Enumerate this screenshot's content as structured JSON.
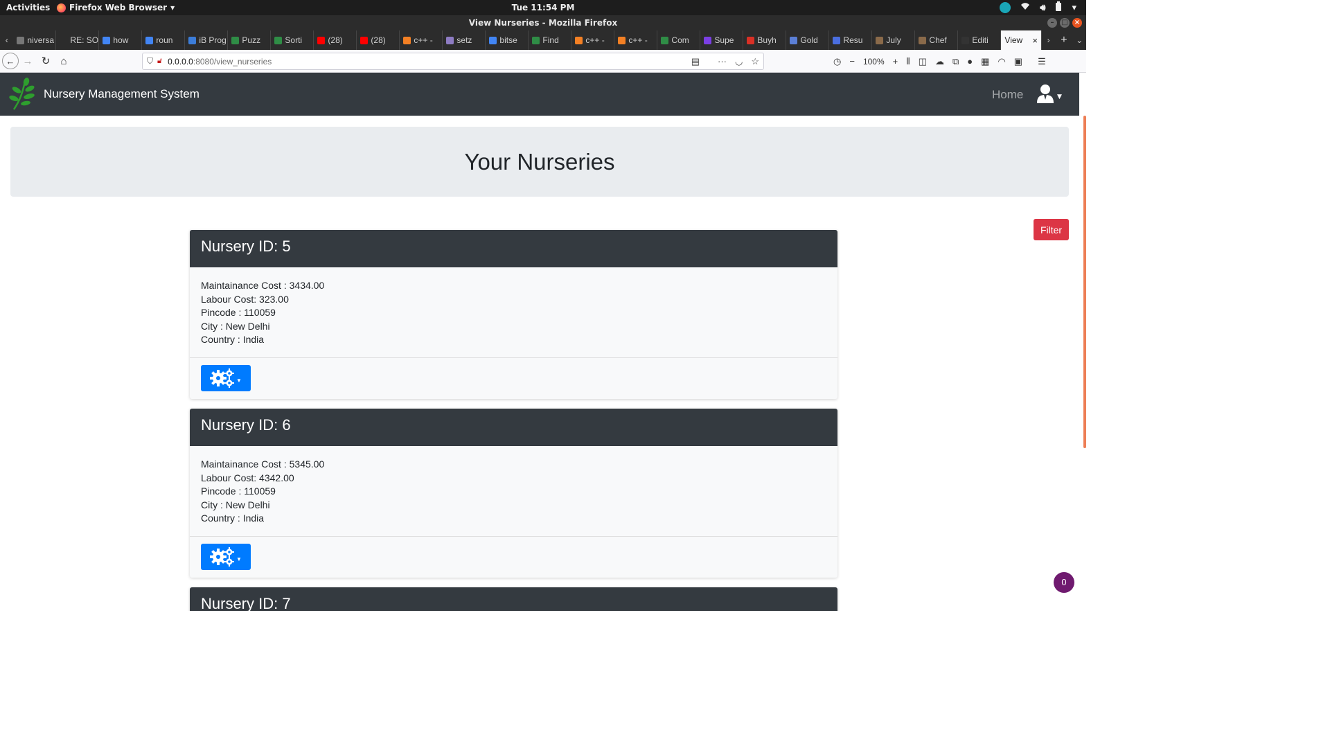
{
  "os": {
    "activities": "Activities",
    "app_menu": "Firefox Web Browser",
    "clock": "Tue 11:54 PM"
  },
  "window": {
    "title": "View Nurseries - Mozilla Firefox"
  },
  "tabs": [
    {
      "label": "niversa",
      "color": "#777777"
    },
    {
      "label": "RE: SOP",
      "color": "#2c2c2c"
    },
    {
      "label": "how",
      "color": "#4285f4"
    },
    {
      "label": "roun",
      "color": "#4285f4"
    },
    {
      "label": "iB Prog",
      "color": "#3c7dd9"
    },
    {
      "label": "Puzz",
      "color": "#2f8d46"
    },
    {
      "label": "Sorti",
      "color": "#2f8d46"
    },
    {
      "label": "(28)",
      "color": "#ff0000"
    },
    {
      "label": "(28)",
      "color": "#ff0000"
    },
    {
      "label": "c++ -",
      "color": "#f48024"
    },
    {
      "label": "setz",
      "color": "#8e7cc3"
    },
    {
      "label": "bitse",
      "color": "#4285f4"
    },
    {
      "label": "Find",
      "color": "#2f8d46"
    },
    {
      "label": "c++ -",
      "color": "#f48024"
    },
    {
      "label": "c++ -",
      "color": "#f48024"
    },
    {
      "label": "Com",
      "color": "#2f8d46"
    },
    {
      "label": "Supe",
      "color": "#7b3fe4"
    },
    {
      "label": "Buyh",
      "color": "#d93025"
    },
    {
      "label": "Gold",
      "color": "#5b7fd6"
    },
    {
      "label": "Resu",
      "color": "#4a6ee0"
    },
    {
      "label": "July",
      "color": "#8a6a4a"
    },
    {
      "label": "Chef",
      "color": "#8a6a4a"
    },
    {
      "label": "Editi",
      "color": "#333333"
    }
  ],
  "active_tab": {
    "label": "View"
  },
  "address": {
    "host": "0.0.0.0",
    "path": ":8080/view_nurseries",
    "zoom": "100%"
  },
  "app": {
    "brand": "Nursery Management System",
    "nav_home": "Home",
    "page_title": "Your Nurseries",
    "filter_label": "Filter",
    "notification_count": "0"
  },
  "nurseries": [
    {
      "title": "Nursery ID: 5",
      "maintenance": "Maintainance Cost : 3434.00",
      "labour": "Labour Cost: 323.00",
      "pincode": "Pincode : 110059",
      "city": "City : New Delhi",
      "country": "Country : India"
    },
    {
      "title": "Nursery ID: 6",
      "maintenance": "Maintainance Cost : 5345.00",
      "labour": "Labour Cost: 4342.00",
      "pincode": "Pincode : 110059",
      "city": "City : New Delhi",
      "country": "Country : India"
    },
    {
      "title": "Nursery ID: 7"
    }
  ],
  "colors": {
    "navbar": "#343a40",
    "primary": "#007bff",
    "danger": "#dc3545",
    "jumbotron": "#e9ecef",
    "leaf": "#2e9e2e"
  }
}
